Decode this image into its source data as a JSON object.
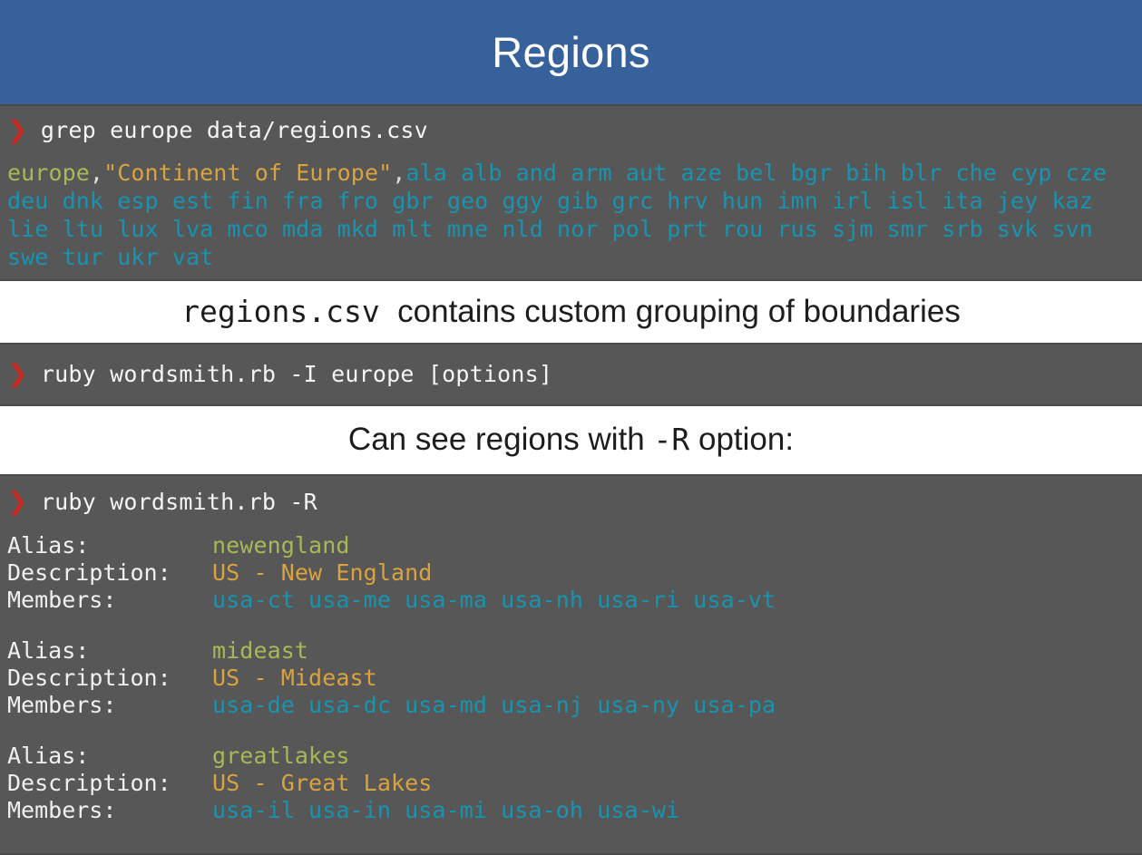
{
  "header": {
    "title": "Regions"
  },
  "colors": {
    "header_blue": "#36619b",
    "terminal_grey": "#575757",
    "prompt_red": "#c62b22",
    "alias_olive": "#a8b856",
    "description_gold": "#d9a33f",
    "member_cyan": "#1894b0",
    "text_white": "#f2f2f2",
    "caption_black": "#1d1d1d"
  },
  "prompt": {
    "glyph": "❯",
    "icon_name": "prompt-chevron-icon"
  },
  "terminal_grep": {
    "command": "grep europe data/regions.csv",
    "output": {
      "alias": "europe",
      "sep1": ",",
      "description": "\"Continent of Europe\"",
      "sep2": ",",
      "members": "ala alb and arm aut aze bel bgr bih blr che cyp cze deu dnk esp est fin fra fro gbr geo ggy gib grc hrv hun imn irl isl ita jey kaz lie ltu lux lva mco mda mkd mlt mne nld nor pol prt rou rus sjm smr srb svk svn swe tur ukr vat"
    }
  },
  "caption_1": {
    "mono_part": "regions.csv",
    "text_part": "  contains custom grouping of boundaries"
  },
  "terminal_include": {
    "command": "ruby wordsmith.rb -I europe [options]"
  },
  "caption_2": {
    "text_before": "Can see regions with ",
    "mono_part": "-R",
    "text_after": " option:"
  },
  "terminal_regions": {
    "command": "ruby wordsmith.rb -R",
    "labels": {
      "alias": "Alias:",
      "description": "Description:",
      "members": "Members:"
    },
    "groups": [
      {
        "alias": "newengland",
        "description": "US - New England",
        "members": "usa-ct usa-me usa-ma usa-nh usa-ri usa-vt"
      },
      {
        "alias": "mideast",
        "description": "US - Mideast",
        "members": "usa-de usa-dc usa-md usa-nj usa-ny usa-pa"
      },
      {
        "alias": "greatlakes",
        "description": "US - Great Lakes",
        "members": "usa-il usa-in usa-mi usa-oh usa-wi"
      }
    ]
  }
}
